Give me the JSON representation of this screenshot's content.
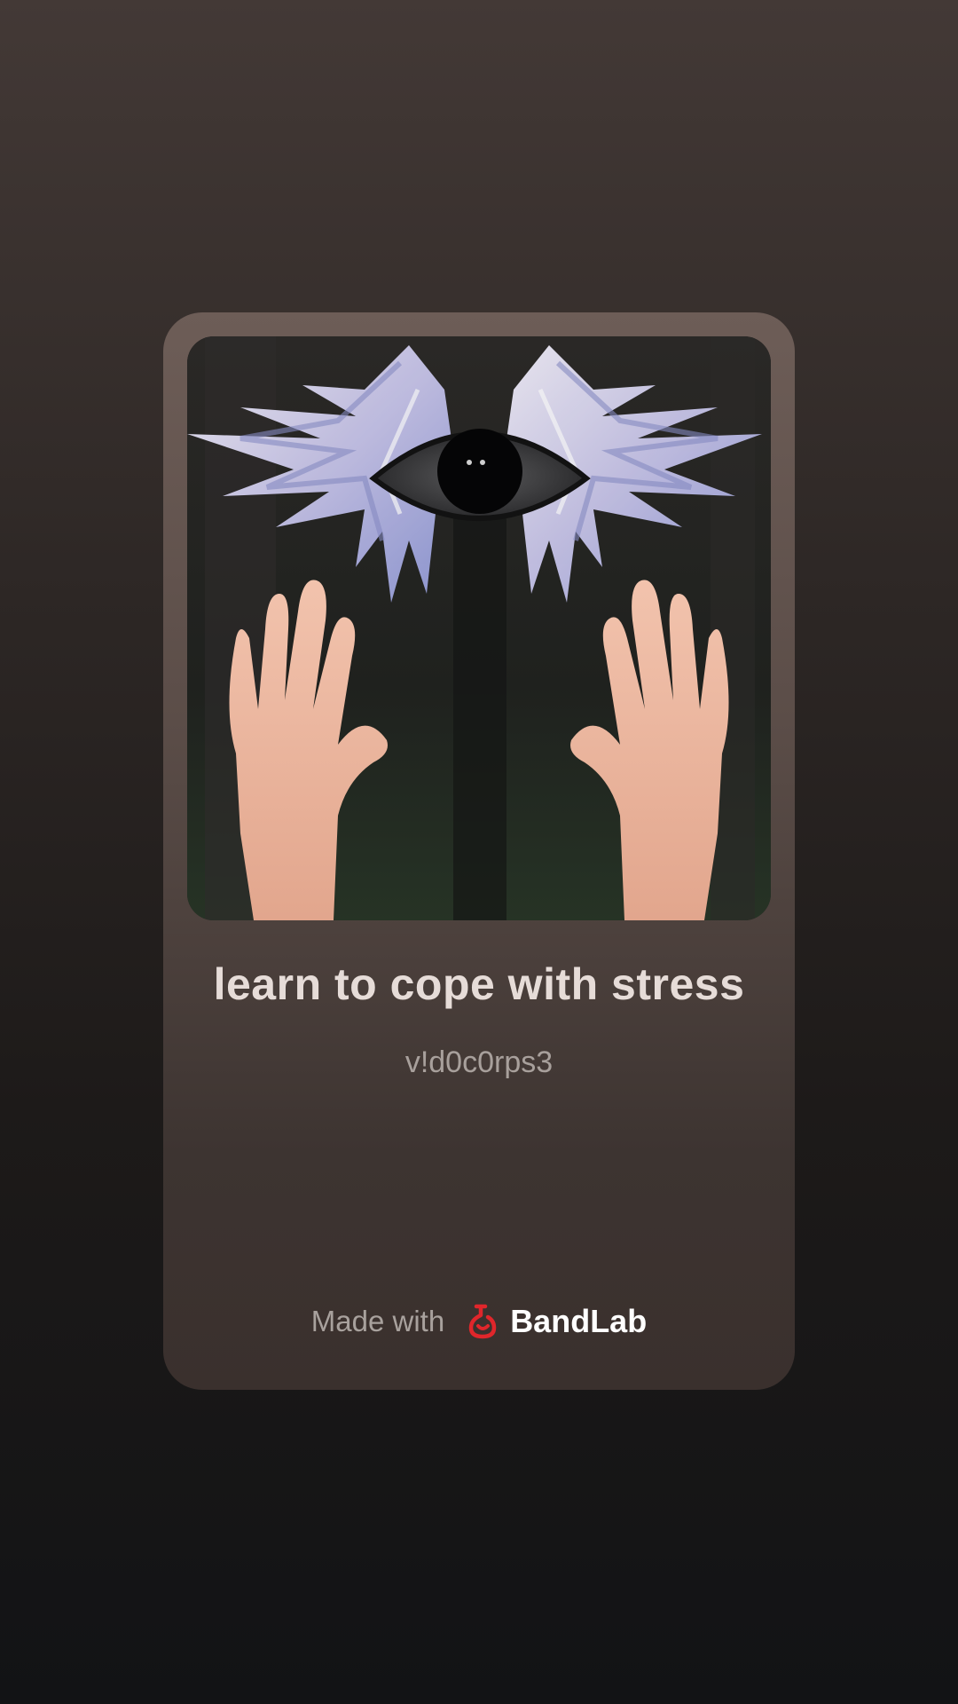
{
  "track": {
    "title": "learn to cope with stress",
    "artist": "v!d0c0rps3",
    "cover_art": "winged-eye-over-raised-hands"
  },
  "footer": {
    "made_with": "Made with",
    "brand": "BandLab",
    "brand_icon": "bandlab-logo-icon"
  },
  "colors": {
    "brand_red": "#e0262b",
    "card_top": "#6d5d57",
    "card_bottom": "#3a302d",
    "title_text": "#e6dcd8",
    "artist_text": "#a8a09c"
  }
}
